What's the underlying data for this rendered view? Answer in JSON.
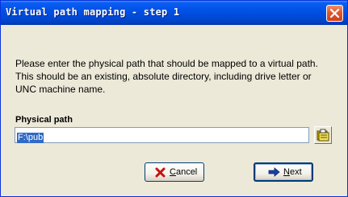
{
  "window": {
    "title": "Virtual path mapping - step 1",
    "close_icon": "close-icon"
  },
  "message": "Please enter the physical path that should be mapped to a virtual path. This should be an existing, absolute directory, including drive letter or UNC machine name.",
  "physical_path": {
    "label": "Physical path",
    "value": "F:\\pub",
    "browse_icon": "folder-browse-icon"
  },
  "buttons": {
    "cancel": {
      "mnemonic": "C",
      "rest": "ancel",
      "icon": "red-x-icon"
    },
    "next": {
      "mnemonic": "N",
      "rest": "ext",
      "icon": "arrow-right-icon"
    }
  },
  "colors": {
    "titlebar": "#0052e6",
    "window_bg": "#ece9d8",
    "selection": "#316ac5",
    "close_button": "#e2582d"
  }
}
